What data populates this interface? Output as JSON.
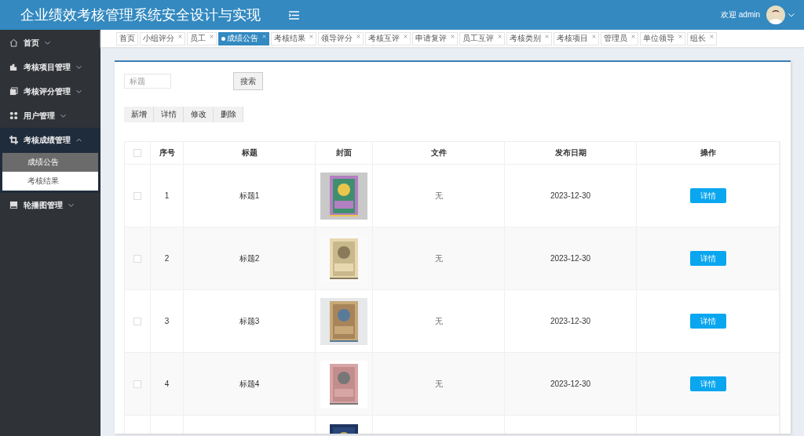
{
  "header": {
    "title": "企业绩效考核管理系统安全设计与实现",
    "welcome": "欢迎 admin"
  },
  "sidebar": {
    "items": [
      {
        "label": "首页",
        "expanded": false
      },
      {
        "label": "考核项目管理",
        "expanded": false
      },
      {
        "label": "考核评分管理",
        "expanded": false
      },
      {
        "label": "用户管理",
        "expanded": false
      },
      {
        "label": "考核成绩管理",
        "expanded": true,
        "children": [
          {
            "label": "成绩公告",
            "selected": true
          },
          {
            "label": "考核结果",
            "selected": false
          }
        ]
      },
      {
        "label": "轮播图管理",
        "expanded": false
      }
    ]
  },
  "tabs": [
    {
      "label": "首页",
      "selected": false,
      "closable": false
    },
    {
      "label": "小组评分",
      "selected": false,
      "closable": true
    },
    {
      "label": "员工",
      "selected": false,
      "closable": true
    },
    {
      "label": "成绩公告",
      "selected": true,
      "closable": true
    },
    {
      "label": "考核结果",
      "selected": false,
      "closable": true
    },
    {
      "label": "领导评分",
      "selected": false,
      "closable": true
    },
    {
      "label": "考核互评",
      "selected": false,
      "closable": true
    },
    {
      "label": "申请复评",
      "selected": false,
      "closable": true
    },
    {
      "label": "员工互评",
      "selected": false,
      "closable": true
    },
    {
      "label": "考核类别",
      "selected": false,
      "closable": true
    },
    {
      "label": "考核项目",
      "selected": false,
      "closable": true
    },
    {
      "label": "管理员",
      "selected": false,
      "closable": true
    },
    {
      "label": "单位领导",
      "selected": false,
      "closable": true
    },
    {
      "label": "组长",
      "selected": false,
      "closable": true
    }
  ],
  "search": {
    "placeholder": "标题",
    "button": "搜索"
  },
  "actions": [
    "新增",
    "详情",
    "修改",
    "删除"
  ],
  "table": {
    "all_checked": false,
    "columns": [
      "序号",
      "标题",
      "封面",
      "文件",
      "发布日期",
      "操作"
    ],
    "rows": [
      {
        "checked": false,
        "no": "1",
        "title": "标题1",
        "cover": {
          "kind": "picture"
        },
        "file": "无",
        "date": "2023-12-30",
        "action": "详情"
      },
      {
        "checked": false,
        "no": "2",
        "title": "标题2",
        "cover": {
          "kind": "picture"
        },
        "file": "无",
        "date": "2023-12-30",
        "action": "详情"
      },
      {
        "checked": false,
        "no": "3",
        "title": "标题3",
        "cover": {
          "kind": "picture"
        },
        "file": "无",
        "date": "2023-12-30",
        "action": "详情"
      },
      {
        "checked": false,
        "no": "4",
        "title": "标题4",
        "cover": {
          "kind": "picture"
        },
        "file": "无",
        "date": "2023-12-30",
        "action": "详情"
      },
      {
        "cover": {
          "kind": "picture"
        }
      }
    ]
  }
}
